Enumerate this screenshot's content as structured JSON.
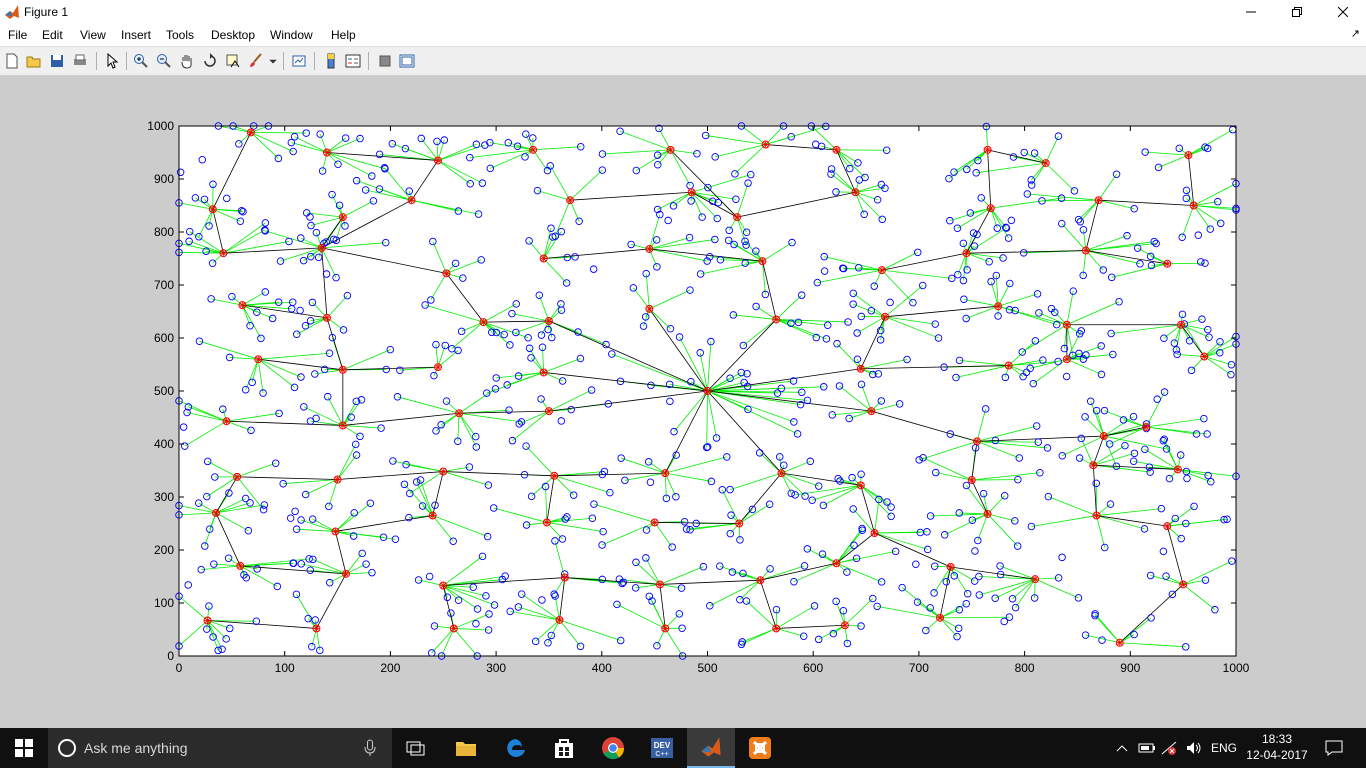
{
  "window": {
    "title": "Figure 1"
  },
  "menu": {
    "items": [
      "File",
      "Edit",
      "View",
      "Insert",
      "Tools",
      "Desktop",
      "Window",
      "Help"
    ],
    "dock_glyph": "↗"
  },
  "toolbar": {
    "icons": [
      "new-figure-icon",
      "open-file-icon",
      "save-figure-icon",
      "print-figure-icon",
      "edit-plot-icon",
      "zoom-in-icon",
      "zoom-out-icon",
      "pan-icon",
      "rotate-3d-icon",
      "data-cursor-icon",
      "brush-icon",
      "link-plot-icon",
      "insert-colorbar-icon",
      "insert-legend-icon",
      "hide-plot-tools-icon",
      "show-plot-tools-icon"
    ]
  },
  "colors": {
    "node": "#0000ff",
    "cluster_head": "#ff0000",
    "member_link": "#00ee00",
    "backbone_link": "#000000"
  },
  "chart_data": {
    "type": "scatter",
    "title": "",
    "xlabel": "",
    "ylabel": "",
    "xlim": [
      0,
      1000
    ],
    "ylim": [
      0,
      1000
    ],
    "xticks": [
      0,
      100,
      200,
      300,
      400,
      500,
      600,
      700,
      800,
      900,
      1000
    ],
    "yticks": [
      0,
      100,
      200,
      300,
      400,
      500,
      600,
      700,
      800,
      900,
      1000
    ],
    "grid": false,
    "sink": [
      500,
      500
    ],
    "cluster_heads": [
      [
        68,
        988
      ],
      [
        140,
        950
      ],
      [
        245,
        935
      ],
      [
        335,
        955
      ],
      [
        465,
        955
      ],
      [
        555,
        965
      ],
      [
        622,
        955
      ],
      [
        765,
        955
      ],
      [
        820,
        930
      ],
      [
        955,
        945
      ],
      [
        32,
        843
      ],
      [
        155,
        828
      ],
      [
        220,
        860
      ],
      [
        370,
        860
      ],
      [
        485,
        875
      ],
      [
        528,
        828
      ],
      [
        640,
        875
      ],
      [
        768,
        845
      ],
      [
        870,
        860
      ],
      [
        960,
        850
      ],
      [
        42,
        760
      ],
      [
        135,
        770
      ],
      [
        253,
        722
      ],
      [
        345,
        750
      ],
      [
        445,
        768
      ],
      [
        552,
        745
      ],
      [
        665,
        728
      ],
      [
        745,
        760
      ],
      [
        858,
        765
      ],
      [
        935,
        740
      ],
      [
        60,
        662
      ],
      [
        140,
        638
      ],
      [
        288,
        630
      ],
      [
        350,
        632
      ],
      [
        445,
        655
      ],
      [
        565,
        635
      ],
      [
        668,
        640
      ],
      [
        775,
        660
      ],
      [
        840,
        625
      ],
      [
        948,
        625
      ],
      [
        75,
        560
      ],
      [
        155,
        540
      ],
      [
        245,
        545
      ],
      [
        345,
        535
      ],
      [
        645,
        542
      ],
      [
        785,
        548
      ],
      [
        840,
        560
      ],
      [
        970,
        565
      ],
      [
        45,
        443
      ],
      [
        155,
        435
      ],
      [
        265,
        458
      ],
      [
        350,
        462
      ],
      [
        655,
        462
      ],
      [
        755,
        405
      ],
      [
        875,
        415
      ],
      [
        915,
        432
      ],
      [
        55,
        338
      ],
      [
        150,
        333
      ],
      [
        250,
        348
      ],
      [
        355,
        340
      ],
      [
        460,
        345
      ],
      [
        570,
        345
      ],
      [
        645,
        322
      ],
      [
        750,
        332
      ],
      [
        865,
        360
      ],
      [
        945,
        352
      ],
      [
        35,
        270
      ],
      [
        148,
        235
      ],
      [
        240,
        265
      ],
      [
        348,
        252
      ],
      [
        450,
        252
      ],
      [
        530,
        250
      ],
      [
        658,
        232
      ],
      [
        765,
        268
      ],
      [
        868,
        265
      ],
      [
        935,
        245
      ],
      [
        58,
        170
      ],
      [
        158,
        155
      ],
      [
        250,
        133
      ],
      [
        365,
        148
      ],
      [
        455,
        135
      ],
      [
        550,
        143
      ],
      [
        622,
        175
      ],
      [
        730,
        168
      ],
      [
        810,
        145
      ],
      [
        27,
        67
      ],
      [
        130,
        52
      ],
      [
        260,
        52
      ],
      [
        360,
        68
      ],
      [
        460,
        52
      ],
      [
        565,
        52
      ],
      [
        630,
        58
      ],
      [
        720,
        72
      ],
      [
        890,
        25
      ],
      [
        950,
        135
      ]
    ],
    "backbone": [
      [
        [
          500,
          500
        ],
        [
          345,
          535
        ]
      ],
      [
        [
          500,
          500
        ],
        [
          350,
          462
        ]
      ],
      [
        [
          500,
          500
        ],
        [
          445,
          655
        ]
      ],
      [
        [
          500,
          500
        ],
        [
          350,
          632
        ]
      ],
      [
        [
          500,
          500
        ],
        [
          565,
          635
        ]
      ],
      [
        [
          500,
          500
        ],
        [
          645,
          542
        ]
      ],
      [
        [
          500,
          500
        ],
        [
          655,
          462
        ]
      ],
      [
        [
          500,
          500
        ],
        [
          570,
          345
        ]
      ],
      [
        [
          500,
          500
        ],
        [
          460,
          345
        ]
      ],
      [
        [
          68,
          988
        ],
        [
          32,
          843
        ]
      ],
      [
        [
          32,
          843
        ],
        [
          42,
          760
        ]
      ],
      [
        [
          42,
          760
        ],
        [
          135,
          770
        ]
      ],
      [
        [
          135,
          770
        ],
        [
          155,
          828
        ]
      ],
      [
        [
          135,
          770
        ],
        [
          220,
          860
        ]
      ],
      [
        [
          220,
          860
        ],
        [
          245,
          935
        ]
      ],
      [
        [
          140,
          950
        ],
        [
          245,
          935
        ]
      ],
      [
        [
          135,
          770
        ],
        [
          140,
          638
        ]
      ],
      [
        [
          60,
          662
        ],
        [
          140,
          638
        ]
      ],
      [
        [
          140,
          638
        ],
        [
          155,
          540
        ]
      ],
      [
        [
          75,
          560
        ],
        [
          155,
          540
        ]
      ],
      [
        [
          155,
          540
        ],
        [
          245,
          545
        ]
      ],
      [
        [
          155,
          540
        ],
        [
          155,
          435
        ]
      ],
      [
        [
          45,
          443
        ],
        [
          155,
          435
        ]
      ],
      [
        [
          135,
          770
        ],
        [
          253,
          722
        ]
      ],
      [
        [
          253,
          722
        ],
        [
          288,
          630
        ]
      ],
      [
        [
          288,
          630
        ],
        [
          350,
          632
        ]
      ],
      [
        [
          370,
          860
        ],
        [
          485,
          875
        ]
      ],
      [
        [
          485,
          875
        ],
        [
          528,
          828
        ]
      ],
      [
        [
          465,
          955
        ],
        [
          528,
          828
        ]
      ],
      [
        [
          528,
          828
        ],
        [
          640,
          875
        ]
      ],
      [
        [
          622,
          955
        ],
        [
          640,
          875
        ]
      ],
      [
        [
          555,
          965
        ],
        [
          622,
          955
        ]
      ],
      [
        [
          345,
          750
        ],
        [
          445,
          768
        ]
      ],
      [
        [
          445,
          768
        ],
        [
          552,
          745
        ]
      ],
      [
        [
          552,
          745
        ],
        [
          565,
          635
        ]
      ],
      [
        [
          665,
          728
        ],
        [
          745,
          760
        ]
      ],
      [
        [
          745,
          760
        ],
        [
          768,
          845
        ]
      ],
      [
        [
          765,
          955
        ],
        [
          768,
          845
        ]
      ],
      [
        [
          765,
          955
        ],
        [
          820,
          930
        ]
      ],
      [
        [
          745,
          760
        ],
        [
          858,
          765
        ]
      ],
      [
        [
          858,
          765
        ],
        [
          870,
          860
        ]
      ],
      [
        [
          870,
          860
        ],
        [
          960,
          850
        ]
      ],
      [
        [
          955,
          945
        ],
        [
          960,
          850
        ]
      ],
      [
        [
          858,
          765
        ],
        [
          935,
          740
        ]
      ],
      [
        [
          668,
          640
        ],
        [
          775,
          660
        ]
      ],
      [
        [
          645,
          542
        ],
        [
          668,
          640
        ]
      ],
      [
        [
          645,
          542
        ],
        [
          785,
          548
        ]
      ],
      [
        [
          840,
          625
        ],
        [
          948,
          625
        ]
      ],
      [
        [
          948,
          625
        ],
        [
          970,
          565
        ]
      ],
      [
        [
          840,
          625
        ],
        [
          840,
          560
        ]
      ],
      [
        [
          265,
          458
        ],
        [
          350,
          462
        ]
      ],
      [
        [
          155,
          435
        ],
        [
          265,
          458
        ]
      ],
      [
        [
          655,
          462
        ],
        [
          755,
          405
        ]
      ],
      [
        [
          755,
          405
        ],
        [
          875,
          415
        ]
      ],
      [
        [
          875,
          415
        ],
        [
          915,
          432
        ]
      ],
      [
        [
          875,
          415
        ],
        [
          865,
          360
        ]
      ],
      [
        [
          865,
          360
        ],
        [
          945,
          352
        ]
      ],
      [
        [
          755,
          405
        ],
        [
          750,
          332
        ]
      ],
      [
        [
          750,
          332
        ],
        [
          765,
          268
        ]
      ],
      [
        [
          55,
          338
        ],
        [
          150,
          333
        ]
      ],
      [
        [
          150,
          333
        ],
        [
          250,
          348
        ]
      ],
      [
        [
          250,
          348
        ],
        [
          355,
          340
        ]
      ],
      [
        [
          355,
          340
        ],
        [
          460,
          345
        ]
      ],
      [
        [
          35,
          270
        ],
        [
          55,
          338
        ]
      ],
      [
        [
          35,
          270
        ],
        [
          58,
          170
        ]
      ],
      [
        [
          148,
          235
        ],
        [
          240,
          265
        ]
      ],
      [
        [
          240,
          265
        ],
        [
          250,
          348
        ]
      ],
      [
        [
          348,
          252
        ],
        [
          355,
          340
        ]
      ],
      [
        [
          450,
          252
        ],
        [
          530,
          250
        ]
      ],
      [
        [
          530,
          250
        ],
        [
          570,
          345
        ]
      ],
      [
        [
          570,
          345
        ],
        [
          645,
          322
        ]
      ],
      [
        [
          645,
          322
        ],
        [
          658,
          232
        ]
      ],
      [
        [
          658,
          232
        ],
        [
          622,
          175
        ]
      ],
      [
        [
          658,
          232
        ],
        [
          730,
          168
        ]
      ],
      [
        [
          730,
          168
        ],
        [
          810,
          145
        ]
      ],
      [
        [
          730,
          168
        ],
        [
          720,
          72
        ]
      ],
      [
        [
          622,
          175
        ],
        [
          550,
          143
        ]
      ],
      [
        [
          550,
          143
        ],
        [
          455,
          135
        ]
      ],
      [
        [
          455,
          135
        ],
        [
          365,
          148
        ]
      ],
      [
        [
          365,
          148
        ],
        [
          250,
          133
        ]
      ],
      [
        [
          250,
          133
        ],
        [
          260,
          52
        ]
      ],
      [
        [
          365,
          148
        ],
        [
          360,
          68
        ]
      ],
      [
        [
          455,
          135
        ],
        [
          460,
          52
        ]
      ],
      [
        [
          550,
          143
        ],
        [
          565,
          52
        ]
      ],
      [
        [
          565,
          52
        ],
        [
          630,
          58
        ]
      ],
      [
        [
          148,
          235
        ],
        [
          158,
          155
        ]
      ],
      [
        [
          158,
          155
        ],
        [
          130,
          52
        ]
      ],
      [
        [
          27,
          67
        ],
        [
          130,
          52
        ]
      ],
      [
        [
          58,
          170
        ],
        [
          158,
          155
        ]
      ],
      [
        [
          865,
          360
        ],
        [
          868,
          265
        ]
      ],
      [
        [
          868,
          265
        ],
        [
          935,
          245
        ]
      ],
      [
        [
          935,
          245
        ],
        [
          950,
          135
        ]
      ],
      [
        [
          950,
          135
        ],
        [
          890,
          25
        ]
      ]
    ]
  },
  "taskbar": {
    "search_placeholder": "Ask me anything",
    "apps": [
      "file-explorer-icon",
      "edge-icon",
      "store-icon",
      "chrome-icon",
      "dev-cpp-icon",
      "matlab-icon",
      "xampp-icon"
    ],
    "language": "ENG",
    "time": "18:33",
    "date": "12-04-2017"
  }
}
